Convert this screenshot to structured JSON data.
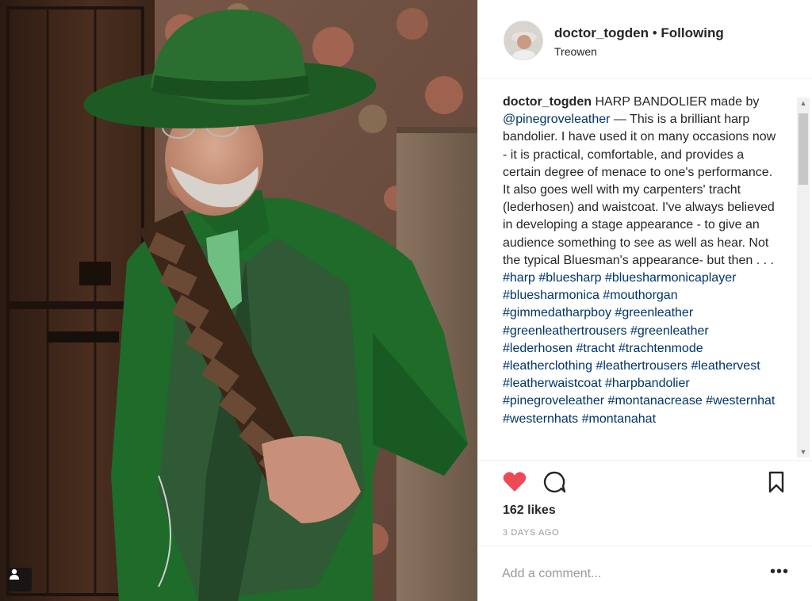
{
  "post": {
    "username": "doctor_togden",
    "separator": " • ",
    "follow_state": "Following",
    "location": "Treowen",
    "caption": {
      "username": "doctor_togden",
      "text_1": " HARP BANDOLIER made by ",
      "mention": "@pinegroveleather",
      "text_2": " — This is a brilliant harp bandolier. I have used it on many occasions now - it is practical, comfortable, and provides a certain degree of menace to one's performance. It also goes well with my carpenters' tracht (lederhosen) and waistcoat. I've always believed in developing a stage appearance - to give an audience something to see as well as hear. Not the typical Bluesman's appearance- but then . . . ",
      "hashtags": "#harp #bluesharp #bluesharmonicaplayer #bluesharmonica #mouthorgan #gimmedatharpboy #greenleather #greenleathertrousers #greenleather #lederhosen #tracht #trachtenmode #leatherclothing #leathertrousers #leathervest #leatherwaistcoat #harpbandolier #pinegroveleather #montanacrease #westernhat #westernhats #montanahat"
    },
    "likes": "162 likes",
    "time": "3 DAYS AGO",
    "comment_placeholder": "Add a comment...",
    "more_label": "•••"
  },
  "icons": {
    "like": "heart-filled-icon",
    "comment": "speech-bubble-icon",
    "save": "bookmark-icon",
    "more": "ellipsis-icon",
    "tagged": "person-icon"
  },
  "colors": {
    "like_red": "#ed4956",
    "link_blue": "#003569",
    "text": "#262626",
    "muted": "#999999"
  }
}
